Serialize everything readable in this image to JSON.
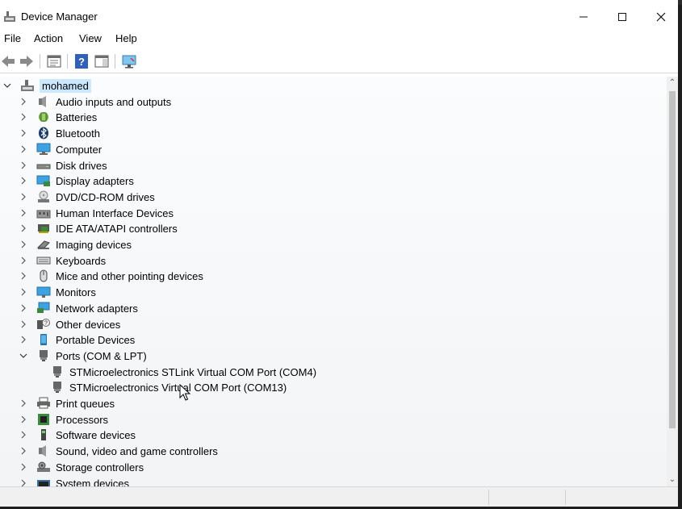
{
  "window": {
    "title": "Device Manager"
  },
  "menu": {
    "items": [
      "File",
      "Action",
      "View",
      "Help"
    ]
  },
  "tree": {
    "root": "mohamed",
    "categories": [
      "Audio inputs and outputs",
      "Batteries",
      "Bluetooth",
      "Computer",
      "Disk drives",
      "Display adapters",
      "DVD/CD-ROM drives",
      "Human Interface Devices",
      "IDE ATA/ATAPI controllers",
      "Imaging devices",
      "Keyboards",
      "Mice and other pointing devices",
      "Monitors",
      "Network adapters",
      "Other devices",
      "Portable Devices",
      "Ports (COM & LPT)",
      "Print queues",
      "Processors",
      "Software devices",
      "Sound, video and game controllers",
      "Storage controllers",
      "System devices"
    ],
    "ports_children": [
      "STMicroelectronics STLink Virtual COM Port (COM4)",
      "STMicroelectronics Virtual COM Port (COM13)"
    ]
  },
  "colors": {
    "selection": "#cce8ff",
    "accent": "#1e6fd9"
  }
}
